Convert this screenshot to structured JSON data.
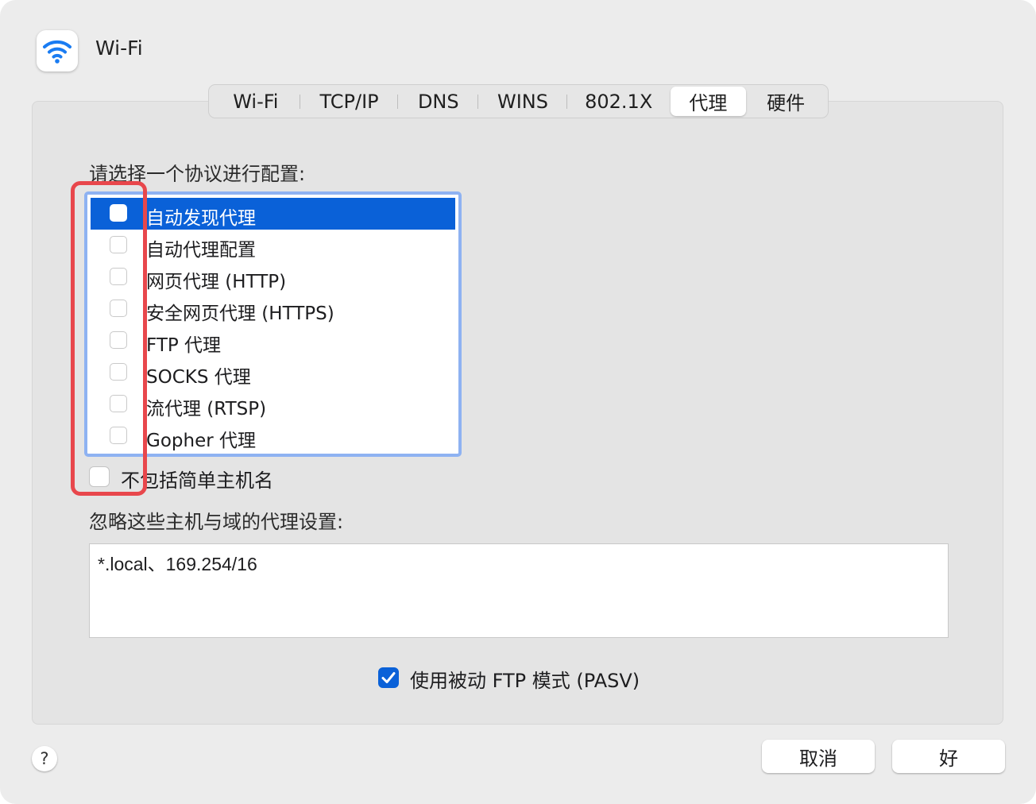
{
  "window": {
    "title": "Wi-Fi",
    "icon": "wifi-icon"
  },
  "tabs": [
    {
      "label": "Wi-Fi",
      "selected": false
    },
    {
      "label": "TCP/IP",
      "selected": false
    },
    {
      "label": "DNS",
      "selected": false
    },
    {
      "label": "WINS",
      "selected": false
    },
    {
      "label": "802.1X",
      "selected": false
    },
    {
      "label": "代理",
      "selected": true
    },
    {
      "label": "硬件",
      "selected": false
    }
  ],
  "protocols": {
    "label": "请选择一个协议进行配置:",
    "items": [
      {
        "label": "自动发现代理",
        "checked": false,
        "selected": true
      },
      {
        "label": "自动代理配置",
        "checked": false,
        "selected": false
      },
      {
        "label": "网页代理 (HTTP)",
        "checked": false,
        "selected": false
      },
      {
        "label": "安全网页代理 (HTTPS)",
        "checked": false,
        "selected": false
      },
      {
        "label": "FTP 代理",
        "checked": false,
        "selected": false
      },
      {
        "label": "SOCKS 代理",
        "checked": false,
        "selected": false
      },
      {
        "label": "流代理 (RTSP)",
        "checked": false,
        "selected": false
      },
      {
        "label": "Gopher 代理",
        "checked": false,
        "selected": false
      }
    ]
  },
  "exclude_simple_hostnames": {
    "label": "不包括简单主机名",
    "checked": false
  },
  "bypass": {
    "label": "忽略这些主机与域的代理设置:",
    "value": "*.local、169.254/16"
  },
  "passive_ftp": {
    "label": "使用被动 FTP 模式 (PASV)",
    "checked": true
  },
  "buttons": {
    "help": "?",
    "cancel": "取消",
    "ok": "好"
  },
  "colors": {
    "accent": "#0a61d8",
    "focus_ring": "#8eb2f2",
    "highlight": "#e8474c"
  }
}
